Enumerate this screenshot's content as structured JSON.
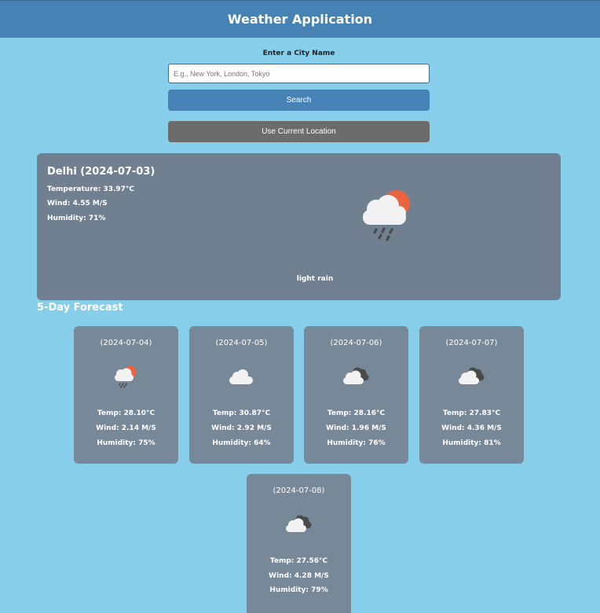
{
  "header": {
    "title": "Weather Application"
  },
  "search": {
    "label": "Enter a City Name",
    "placeholder": "E.g., New York, London, Tokyo",
    "search_button": "Search",
    "location_button": "Use Current Location"
  },
  "current": {
    "title": "Delhi (2024-07-03)",
    "temperature": "Temperature: 33.97°C",
    "wind": "Wind: 4.55 M/S",
    "humidity": "Humidity: 71%",
    "icon": "sun-cloud-rain-icon",
    "description": "light rain"
  },
  "forecast": {
    "title": "5-Day Forecast",
    "days": [
      {
        "date": "(2024-07-04)",
        "icon": "sun-cloud-rain-icon",
        "temp": "Temp: 28.10°C",
        "wind": "Wind: 2.14 M/S",
        "humidity": "Humidity: 75%"
      },
      {
        "date": "(2024-07-05)",
        "icon": "cloud-icon",
        "temp": "Temp: 30.87°C",
        "wind": "Wind: 2.92 M/S",
        "humidity": "Humidity: 64%"
      },
      {
        "date": "(2024-07-06)",
        "icon": "broken-clouds-icon",
        "temp": "Temp: 28.16°C",
        "wind": "Wind: 1.96 M/S",
        "humidity": "Humidity: 76%"
      },
      {
        "date": "(2024-07-07)",
        "icon": "broken-clouds-icon",
        "temp": "Temp: 27.83°C",
        "wind": "Wind: 4.36 M/S",
        "humidity": "Humidity: 81%"
      },
      {
        "date": "(2024-07-08)",
        "icon": "broken-clouds-icon",
        "temp": "Temp: 27.56°C",
        "wind": "Wind: 4.28 M/S",
        "humidity": "Humidity: 79%"
      }
    ]
  },
  "colors": {
    "background": "#87ceeb",
    "header": "#4682b4",
    "current_card": "#708090",
    "forecast_card": "#778899",
    "location_button": "#6c6c6c",
    "sun": "#e8653f"
  }
}
